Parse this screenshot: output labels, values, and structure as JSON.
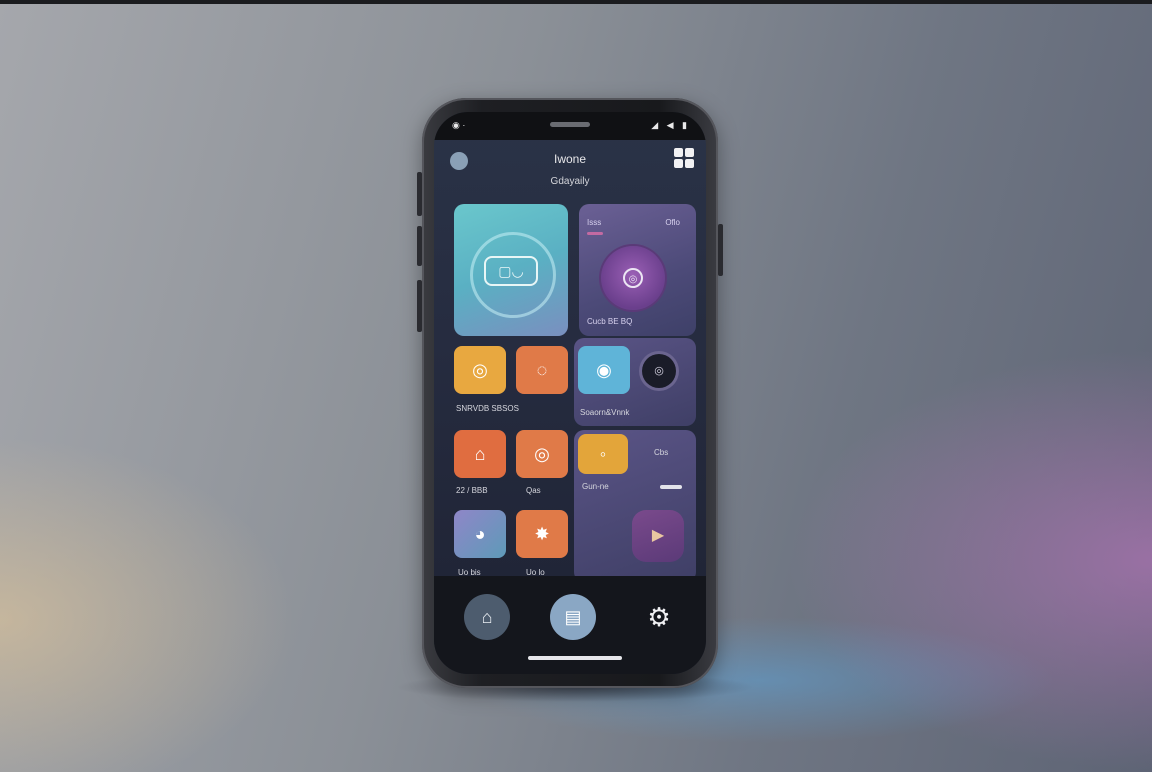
{
  "device": {
    "status_left": "◉ ·",
    "status_right": "◢ ◀ ▮"
  },
  "header": {
    "title": "Iwone",
    "subtitle": "Gdayaily"
  },
  "tiles": {
    "teal_icon": "▢◡",
    "purple_label_left": "Isss",
    "purple_label_right": "Oflo",
    "purple_knob_icon": "◎",
    "purple_caption": "Cucb            BE BQ",
    "row1_left_icon": "◎",
    "row1_mid_icon": "◌",
    "row1_caption": "SNRVDB SBSOS",
    "row1_right_caption": "Soaorn&Vnnk",
    "row1_right_dot_icon": "◉",
    "row2_left_icon": "⌂",
    "row2_mid_icon": "◎",
    "row2_caption_a": "22 / BBB",
    "row2_caption_b": "Qas",
    "row2_right_caption": "Gun-ne",
    "row2_gold_icon": "◦",
    "row2_label": "Cbs",
    "row3_left_icon": "◕",
    "row3_mid_icon": "✸",
    "row3_caption_a": "Uo bis",
    "row3_caption_b": "Uo lo",
    "play_icon": "▶"
  },
  "nav": {
    "left_icon": "⌂",
    "center_icon": "▤",
    "right_icon": "⚙"
  },
  "colors": {
    "accent_teal": "#6ac7cc",
    "accent_orange": "#e07a48",
    "accent_purple": "#6b6095"
  }
}
